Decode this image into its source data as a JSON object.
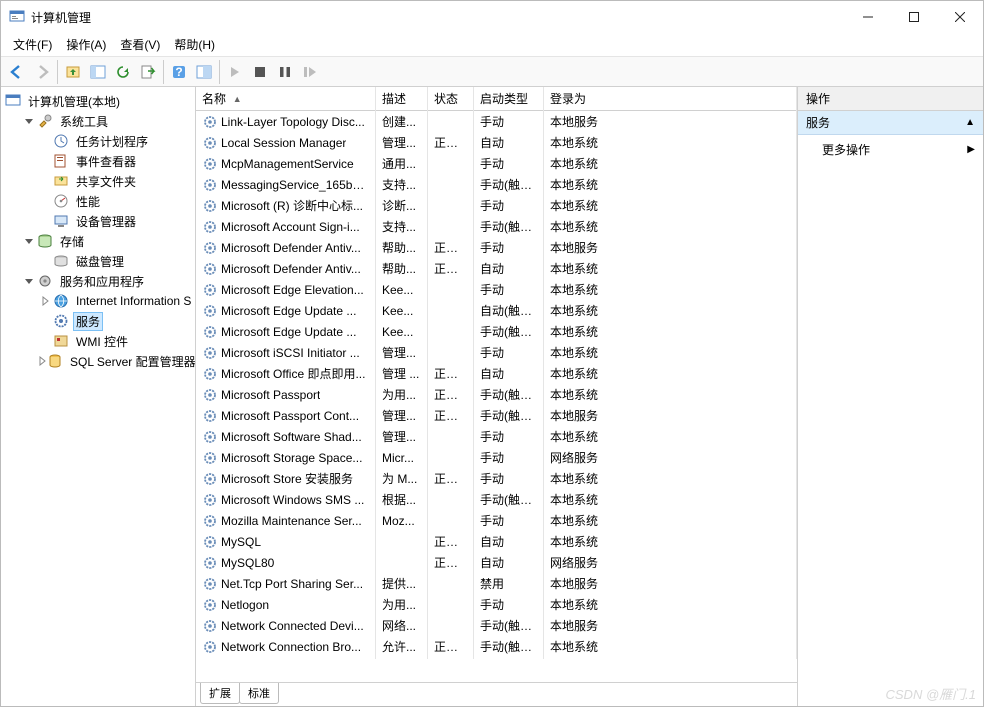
{
  "window": {
    "title": "计算机管理"
  },
  "menu": [
    "文件(F)",
    "操作(A)",
    "查看(V)",
    "帮助(H)"
  ],
  "tree": {
    "root": "计算机管理(本地)",
    "nodes": [
      {
        "label": "系统工具",
        "expanded": true,
        "icon": "tools",
        "children": [
          {
            "label": "任务计划程序",
            "icon": "clock"
          },
          {
            "label": "事件查看器",
            "icon": "event"
          },
          {
            "label": "共享文件夹",
            "icon": "share"
          },
          {
            "label": "性能",
            "icon": "perf"
          },
          {
            "label": "设备管理器",
            "icon": "device"
          }
        ]
      },
      {
        "label": "存储",
        "expanded": true,
        "icon": "storage",
        "children": [
          {
            "label": "磁盘管理",
            "icon": "disk"
          }
        ]
      },
      {
        "label": "服务和应用程序",
        "expanded": true,
        "icon": "gear",
        "children": [
          {
            "label": "Internet Information S",
            "icon": "iis",
            "hasChildren": true
          },
          {
            "label": "服务",
            "icon": "service",
            "selected": true
          },
          {
            "label": "WMI 控件",
            "icon": "wmi"
          },
          {
            "label": "SQL Server 配置管理器",
            "icon": "sql",
            "hasChildren": true
          }
        ]
      }
    ]
  },
  "columns": {
    "name": "名称",
    "desc": "描述",
    "status": "状态",
    "startup": "启动类型",
    "logon": "登录为"
  },
  "sort_indicator": "▲",
  "services": [
    {
      "name": "Link-Layer Topology Disc...",
      "desc": "创建...",
      "status": "",
      "startup": "手动",
      "logon": "本地服务"
    },
    {
      "name": "Local Session Manager",
      "desc": "管理...",
      "status": "正在...",
      "startup": "自动",
      "logon": "本地系统"
    },
    {
      "name": "McpManagementService",
      "desc": "通用...",
      "status": "",
      "startup": "手动",
      "logon": "本地系统"
    },
    {
      "name": "MessagingService_165b5...",
      "desc": "支持...",
      "status": "",
      "startup": "手动(触发...",
      "logon": "本地系统"
    },
    {
      "name": "Microsoft (R) 诊断中心标...",
      "desc": "诊断...",
      "status": "",
      "startup": "手动",
      "logon": "本地系统"
    },
    {
      "name": "Microsoft Account Sign-i...",
      "desc": "支持...",
      "status": "",
      "startup": "手动(触发...",
      "logon": "本地系统"
    },
    {
      "name": "Microsoft Defender Antiv...",
      "desc": "帮助...",
      "status": "正在...",
      "startup": "手动",
      "logon": "本地服务"
    },
    {
      "name": "Microsoft Defender Antiv...",
      "desc": "帮助...",
      "status": "正在...",
      "startup": "自动",
      "logon": "本地系统"
    },
    {
      "name": "Microsoft Edge Elevation...",
      "desc": "Kee...",
      "status": "",
      "startup": "手动",
      "logon": "本地系统"
    },
    {
      "name": "Microsoft Edge Update ...",
      "desc": "Kee...",
      "status": "",
      "startup": "自动(触发...",
      "logon": "本地系统"
    },
    {
      "name": "Microsoft Edge Update ...",
      "desc": "Kee...",
      "status": "",
      "startup": "手动(触发...",
      "logon": "本地系统"
    },
    {
      "name": "Microsoft iSCSI Initiator ...",
      "desc": "管理...",
      "status": "",
      "startup": "手动",
      "logon": "本地系统"
    },
    {
      "name": "Microsoft Office 即点即用...",
      "desc": "管理 ...",
      "status": "正在...",
      "startup": "自动",
      "logon": "本地系统"
    },
    {
      "name": "Microsoft Passport",
      "desc": "为用...",
      "status": "正在...",
      "startup": "手动(触发...",
      "logon": "本地系统"
    },
    {
      "name": "Microsoft Passport Cont...",
      "desc": "管理...",
      "status": "正在...",
      "startup": "手动(触发...",
      "logon": "本地服务"
    },
    {
      "name": "Microsoft Software Shad...",
      "desc": "管理...",
      "status": "",
      "startup": "手动",
      "logon": "本地系统"
    },
    {
      "name": "Microsoft Storage Space...",
      "desc": "Micr...",
      "status": "",
      "startup": "手动",
      "logon": "网络服务"
    },
    {
      "name": "Microsoft Store 安装服务",
      "desc": "为 M...",
      "status": "正在...",
      "startup": "手动",
      "logon": "本地系统"
    },
    {
      "name": "Microsoft Windows SMS ...",
      "desc": "根据...",
      "status": "",
      "startup": "手动(触发...",
      "logon": "本地系统"
    },
    {
      "name": "Mozilla Maintenance Ser...",
      "desc": "Moz...",
      "status": "",
      "startup": "手动",
      "logon": "本地系统"
    },
    {
      "name": "MySQL",
      "desc": "",
      "status": "正在...",
      "startup": "自动",
      "logon": "本地系统"
    },
    {
      "name": "MySQL80",
      "desc": "",
      "status": "正在...",
      "startup": "自动",
      "logon": "网络服务"
    },
    {
      "name": "Net.Tcp Port Sharing Ser...",
      "desc": "提供...",
      "status": "",
      "startup": "禁用",
      "logon": "本地服务"
    },
    {
      "name": "Netlogon",
      "desc": "为用...",
      "status": "",
      "startup": "手动",
      "logon": "本地系统"
    },
    {
      "name": "Network Connected Devi...",
      "desc": "网络...",
      "status": "",
      "startup": "手动(触发...",
      "logon": "本地服务"
    },
    {
      "name": "Network Connection Bro...",
      "desc": "允许...",
      "status": "正在...",
      "startup": "手动(触发...",
      "logon": "本地系统"
    }
  ],
  "tabs_bottom": [
    "扩展",
    "标准"
  ],
  "actions": {
    "header": "操作",
    "group": "服务",
    "more": "更多操作"
  },
  "watermark": "CSDN @雁门.1"
}
